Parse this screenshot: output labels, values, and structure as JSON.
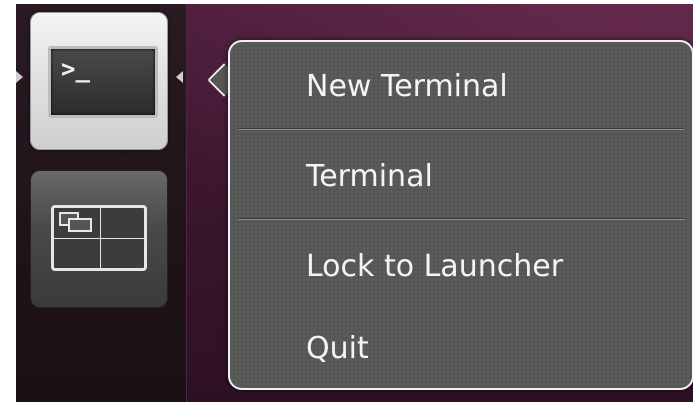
{
  "launcher": {
    "items": [
      {
        "name": "Terminal",
        "icon": "terminal-icon",
        "prompt": ">_",
        "active": true
      },
      {
        "name": "Workspace Switcher",
        "icon": "workspace-switcher-icon",
        "active": false
      }
    ]
  },
  "quicklist": {
    "items": [
      {
        "label": "New Terminal"
      },
      {
        "label": "Terminal"
      },
      {
        "label": "Lock to Launcher"
      },
      {
        "label": "Quit"
      }
    ]
  },
  "colors": {
    "desktop": "#3d1730",
    "launcher": "#1f1319",
    "menu_background": "#565656",
    "menu_border": "#f2f2f2",
    "menu_text": "#f4f4f4"
  }
}
